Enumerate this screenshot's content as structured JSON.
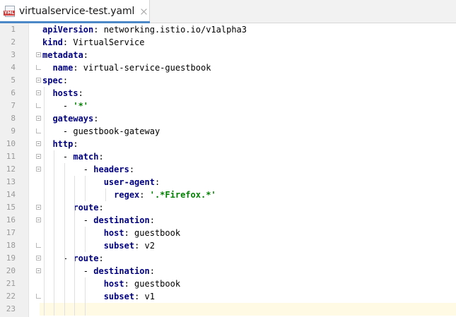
{
  "tab": {
    "icon_label": "YML",
    "title": "virtualservice-test.yaml",
    "close_glyph": "×"
  },
  "lines": [
    {
      "n": "1",
      "indent": "",
      "tokens": [
        {
          "t": "apiVersion",
          "c": "k"
        },
        {
          "t": ": networking.istio.io/v1alpha3",
          "c": ""
        }
      ]
    },
    {
      "n": "2",
      "indent": "",
      "tokens": [
        {
          "t": "kind",
          "c": "k"
        },
        {
          "t": ": VirtualService",
          "c": ""
        }
      ]
    },
    {
      "n": "3",
      "indent": "",
      "tokens": [
        {
          "t": "metadata",
          "c": "k"
        },
        {
          "t": ":",
          "c": ""
        }
      ]
    },
    {
      "n": "4",
      "indent": "  ",
      "tokens": [
        {
          "t": "name",
          "c": "k"
        },
        {
          "t": ": virtual-service-guestbook",
          "c": ""
        }
      ]
    },
    {
      "n": "5",
      "indent": "",
      "tokens": [
        {
          "t": "spec",
          "c": "k"
        },
        {
          "t": ":",
          "c": ""
        }
      ]
    },
    {
      "n": "6",
      "indent": "  ",
      "tokens": [
        {
          "t": "hosts",
          "c": "k"
        },
        {
          "t": ":",
          "c": ""
        }
      ]
    },
    {
      "n": "7",
      "indent": "    ",
      "tokens": [
        {
          "t": "- ",
          "c": ""
        },
        {
          "t": "'*'",
          "c": "s"
        }
      ]
    },
    {
      "n": "8",
      "indent": "  ",
      "tokens": [
        {
          "t": "gateways",
          "c": "k"
        },
        {
          "t": ":",
          "c": ""
        }
      ]
    },
    {
      "n": "9",
      "indent": "    ",
      "tokens": [
        {
          "t": "- guestbook-gateway",
          "c": ""
        }
      ]
    },
    {
      "n": "10",
      "indent": "  ",
      "tokens": [
        {
          "t": "http",
          "c": "k"
        },
        {
          "t": ":",
          "c": ""
        }
      ]
    },
    {
      "n": "11",
      "indent": "    ",
      "tokens": [
        {
          "t": "- ",
          "c": ""
        },
        {
          "t": "match",
          "c": "k"
        },
        {
          "t": ":",
          "c": ""
        }
      ]
    },
    {
      "n": "12",
      "indent": "        ",
      "tokens": [
        {
          "t": "- ",
          "c": ""
        },
        {
          "t": "headers",
          "c": "k"
        },
        {
          "t": ":",
          "c": ""
        }
      ]
    },
    {
      "n": "13",
      "indent": "            ",
      "tokens": [
        {
          "t": "user-agent",
          "c": "k"
        },
        {
          "t": ":",
          "c": ""
        }
      ]
    },
    {
      "n": "14",
      "indent": "              ",
      "tokens": [
        {
          "t": "regex",
          "c": "k"
        },
        {
          "t": ": ",
          "c": ""
        },
        {
          "t": "'.*Firefox.*'",
          "c": "s"
        }
      ]
    },
    {
      "n": "15",
      "indent": "      ",
      "tokens": [
        {
          "t": "route",
          "c": "k"
        },
        {
          "t": ":",
          "c": ""
        }
      ]
    },
    {
      "n": "16",
      "indent": "        ",
      "tokens": [
        {
          "t": "- ",
          "c": ""
        },
        {
          "t": "destination",
          "c": "k"
        },
        {
          "t": ":",
          "c": ""
        }
      ]
    },
    {
      "n": "17",
      "indent": "            ",
      "tokens": [
        {
          "t": "host",
          "c": "k"
        },
        {
          "t": ": guestbook",
          "c": ""
        }
      ]
    },
    {
      "n": "18",
      "indent": "            ",
      "tokens": [
        {
          "t": "subset",
          "c": "k"
        },
        {
          "t": ": v2",
          "c": ""
        }
      ]
    },
    {
      "n": "19",
      "indent": "    ",
      "tokens": [
        {
          "t": "- ",
          "c": ""
        },
        {
          "t": "route",
          "c": "k"
        },
        {
          "t": ":",
          "c": ""
        }
      ]
    },
    {
      "n": "20",
      "indent": "        ",
      "tokens": [
        {
          "t": "- ",
          "c": ""
        },
        {
          "t": "destination",
          "c": "k"
        },
        {
          "t": ":",
          "c": ""
        }
      ]
    },
    {
      "n": "21",
      "indent": "            ",
      "tokens": [
        {
          "t": "host",
          "c": "k"
        },
        {
          "t": ": guestbook",
          "c": ""
        }
      ]
    },
    {
      "n": "22",
      "indent": "            ",
      "tokens": [
        {
          "t": "subset",
          "c": "k"
        },
        {
          "t": ": v1",
          "c": ""
        }
      ]
    },
    {
      "n": "23",
      "indent": "",
      "tokens": []
    }
  ],
  "colors": {
    "key": "#000080",
    "string": "#008000",
    "caret_line": "#fffae3",
    "tab_underline": "#4a88c7"
  }
}
